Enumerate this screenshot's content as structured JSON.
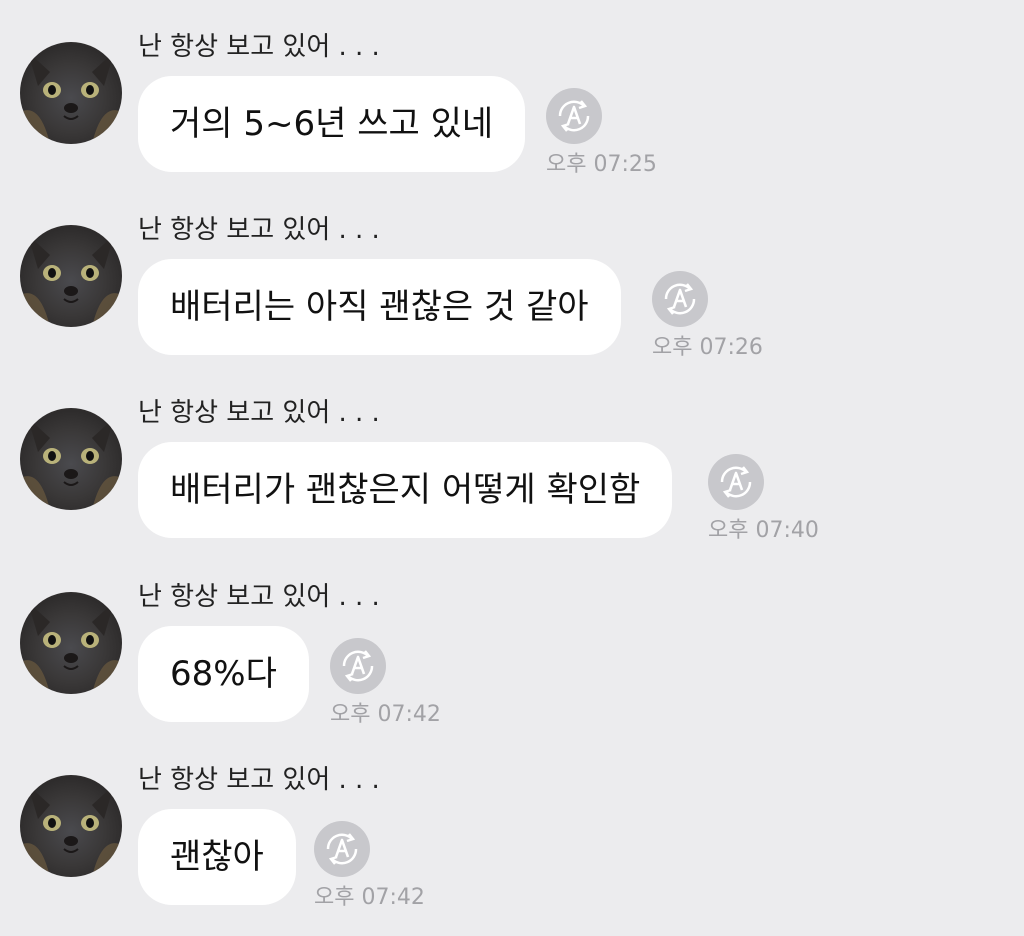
{
  "messages": [
    {
      "sender": "난 항상 보고 있어 . . .",
      "text": "거의 5~6년 쓰고 있네",
      "time": "오후 07:25"
    },
    {
      "sender": "난 항상 보고 있어 . . .",
      "text": "배터리는 아직 괜찮은 것 같아",
      "time": "오후 07:26"
    },
    {
      "sender": "난 항상 보고 있어 . . .",
      "text": "배터리가 괜찮은지 어떻게 확인함",
      "time": "오후 07:40"
    },
    {
      "sender": "난 항상 보고 있어 . . .",
      "text": "68%다",
      "time": "오후 07:42"
    },
    {
      "sender": "난 항상 보고 있어 . . .",
      "text": "괜찮아",
      "time": "오후 07:42"
    }
  ],
  "icons": {
    "avatar": "cat-avatar-icon",
    "status": "auto-translate-retry-icon"
  },
  "colors": {
    "background": "#ececee",
    "bubble": "#ffffff",
    "timestamp": "#a2a2a6",
    "icon": "#c8c8cc"
  }
}
